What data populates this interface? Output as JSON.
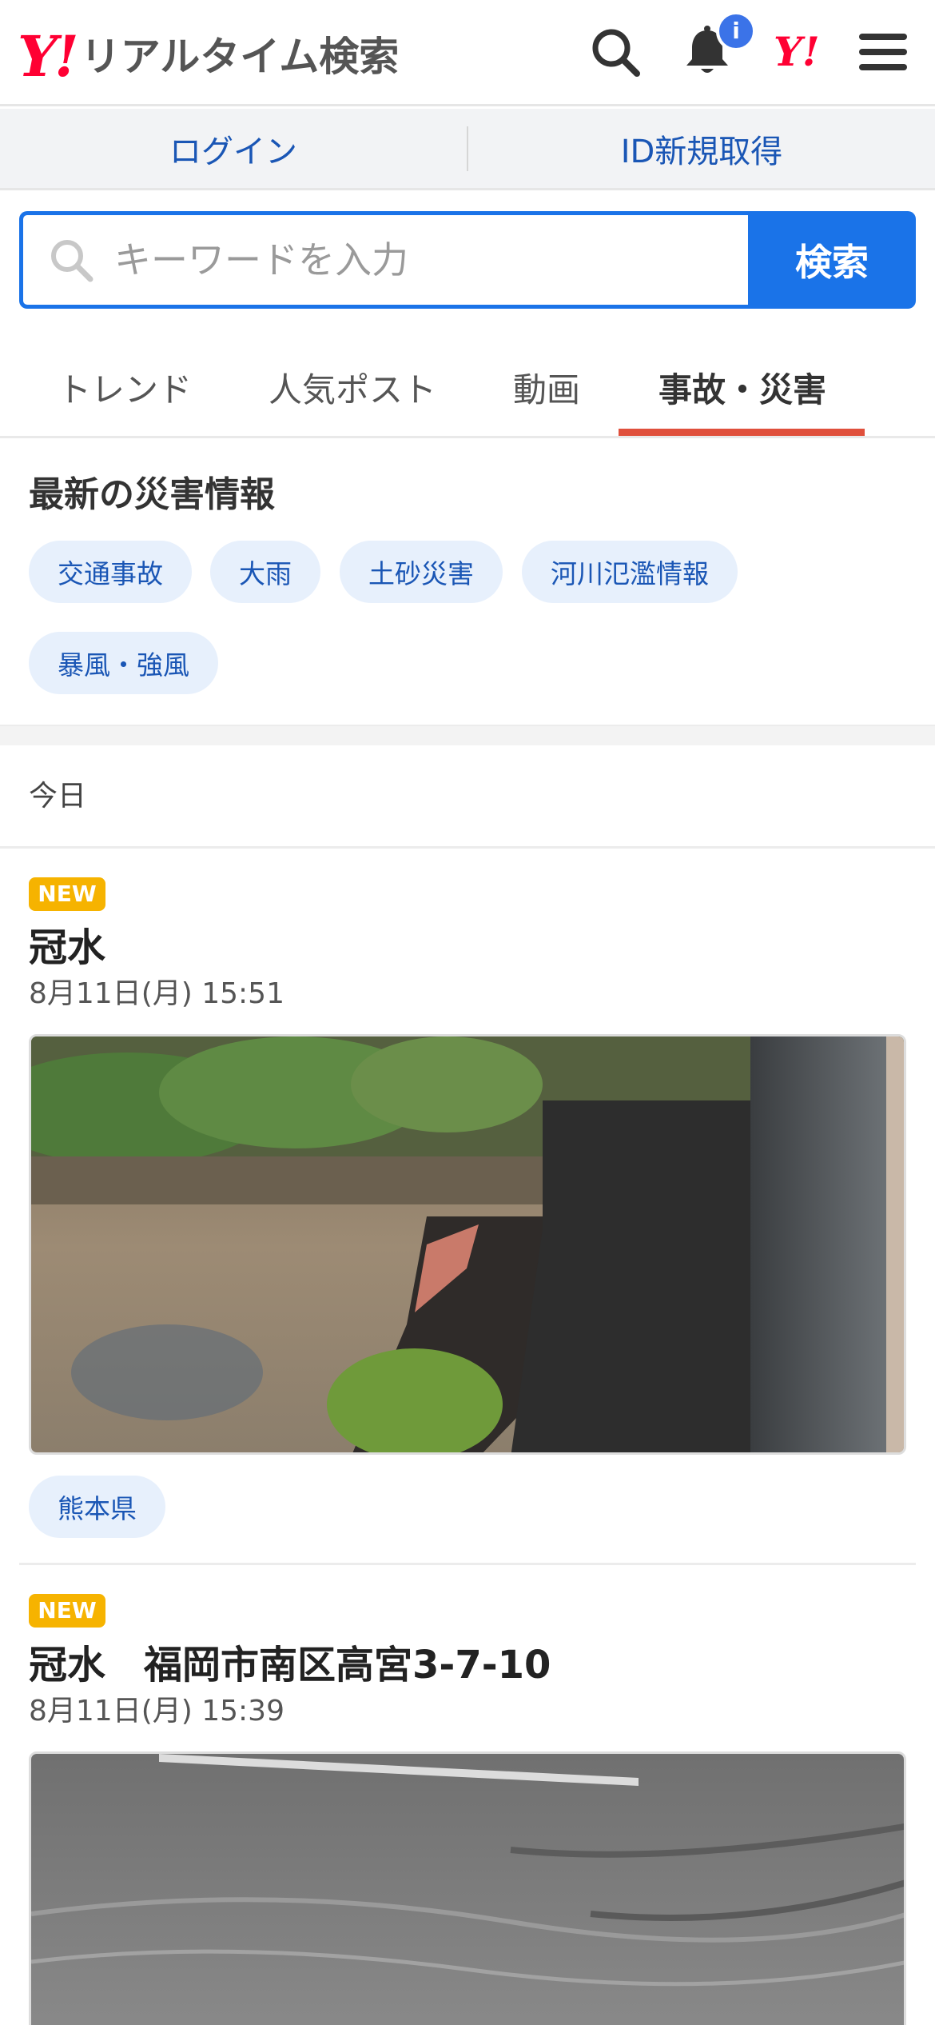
{
  "header": {
    "logo_mark": "Y!",
    "title": "リアルタイム検索",
    "notification_badge": "i",
    "yahoo_mark": "Y!"
  },
  "account": {
    "login": "ログイン",
    "register": "ID新規取得"
  },
  "search": {
    "placeholder": "キーワードを入力",
    "button": "検索"
  },
  "tabs": [
    {
      "label": "トレンド"
    },
    {
      "label": "人気ポスト"
    },
    {
      "label": "動画"
    },
    {
      "label": "事故・災害",
      "active": true
    }
  ],
  "disaster": {
    "title": "最新の災害情報",
    "chips": [
      "交通事故",
      "大雨",
      "土砂災害",
      "河川氾濫情報",
      "暴風・強風"
    ]
  },
  "section_label": "今日",
  "posts": [
    {
      "badge": "NEW",
      "title": "冠水",
      "time": "8月11日(月) 15:51",
      "tag": "熊本県"
    },
    {
      "badge": "NEW",
      "title": "冠水　福岡市南区高宮3-7-10",
      "time": "8月11日(月) 15:39"
    }
  ],
  "colors": {
    "brand_red": "#ff0033",
    "accent_blue": "#1a73e8",
    "tab_underline": "#e0503c",
    "new_badge": "#f6b300"
  }
}
